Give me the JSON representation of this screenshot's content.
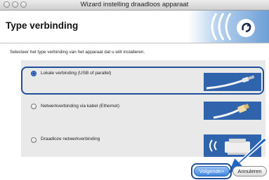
{
  "window": {
    "title": "Wizard instelling draadloos apparaat"
  },
  "header": {
    "title": "Type verbinding"
  },
  "instruction": "Selecteer het type verbinding van het apparaat dat u wilt installeren.",
  "options": [
    {
      "label": "Lokale verbinding (USB of parallel)",
      "selected": true
    },
    {
      "label": "Netwerkverbinding via kabel (Ethernet)",
      "selected": false
    },
    {
      "label": "Draadloze netwerkverbinding",
      "selected": false
    }
  ],
  "buttons": {
    "next": "Volgende>",
    "cancel": "Annuleren"
  },
  "colors": {
    "accent": "#1f4f9a",
    "image_blue": "#2f64ad",
    "panel": "#e9e9e9"
  }
}
